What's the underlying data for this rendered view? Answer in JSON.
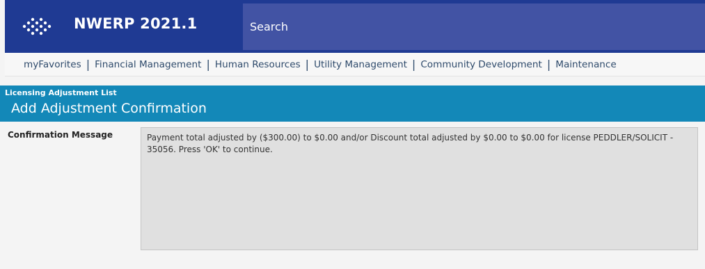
{
  "header": {
    "logo_icon": "nwerp-diamond-dots-icon",
    "app_title": "NWERP 2021.1",
    "search_placeholder": "Search",
    "colors": {
      "topbar": "#1f3a93",
      "search": "#4253a4"
    }
  },
  "nav": {
    "items": [
      "myFavorites",
      "Financial Management",
      "Human Resources",
      "Utility Management",
      "Community Development",
      "Maintenance"
    ],
    "separator": "|"
  },
  "section": {
    "breadcrumb": "Licensing Adjustment List",
    "title": "Add Adjustment Confirmation",
    "color": "#1388b8"
  },
  "form": {
    "confirmation_label": "Confirmation Message",
    "confirmation_message": "Payment total adjusted by ($300.00) to $0.00 and/or Discount total adjusted by $0.00 to $0.00 for license PEDDLER/SOLICIT - 35056. Press 'OK' to continue."
  }
}
